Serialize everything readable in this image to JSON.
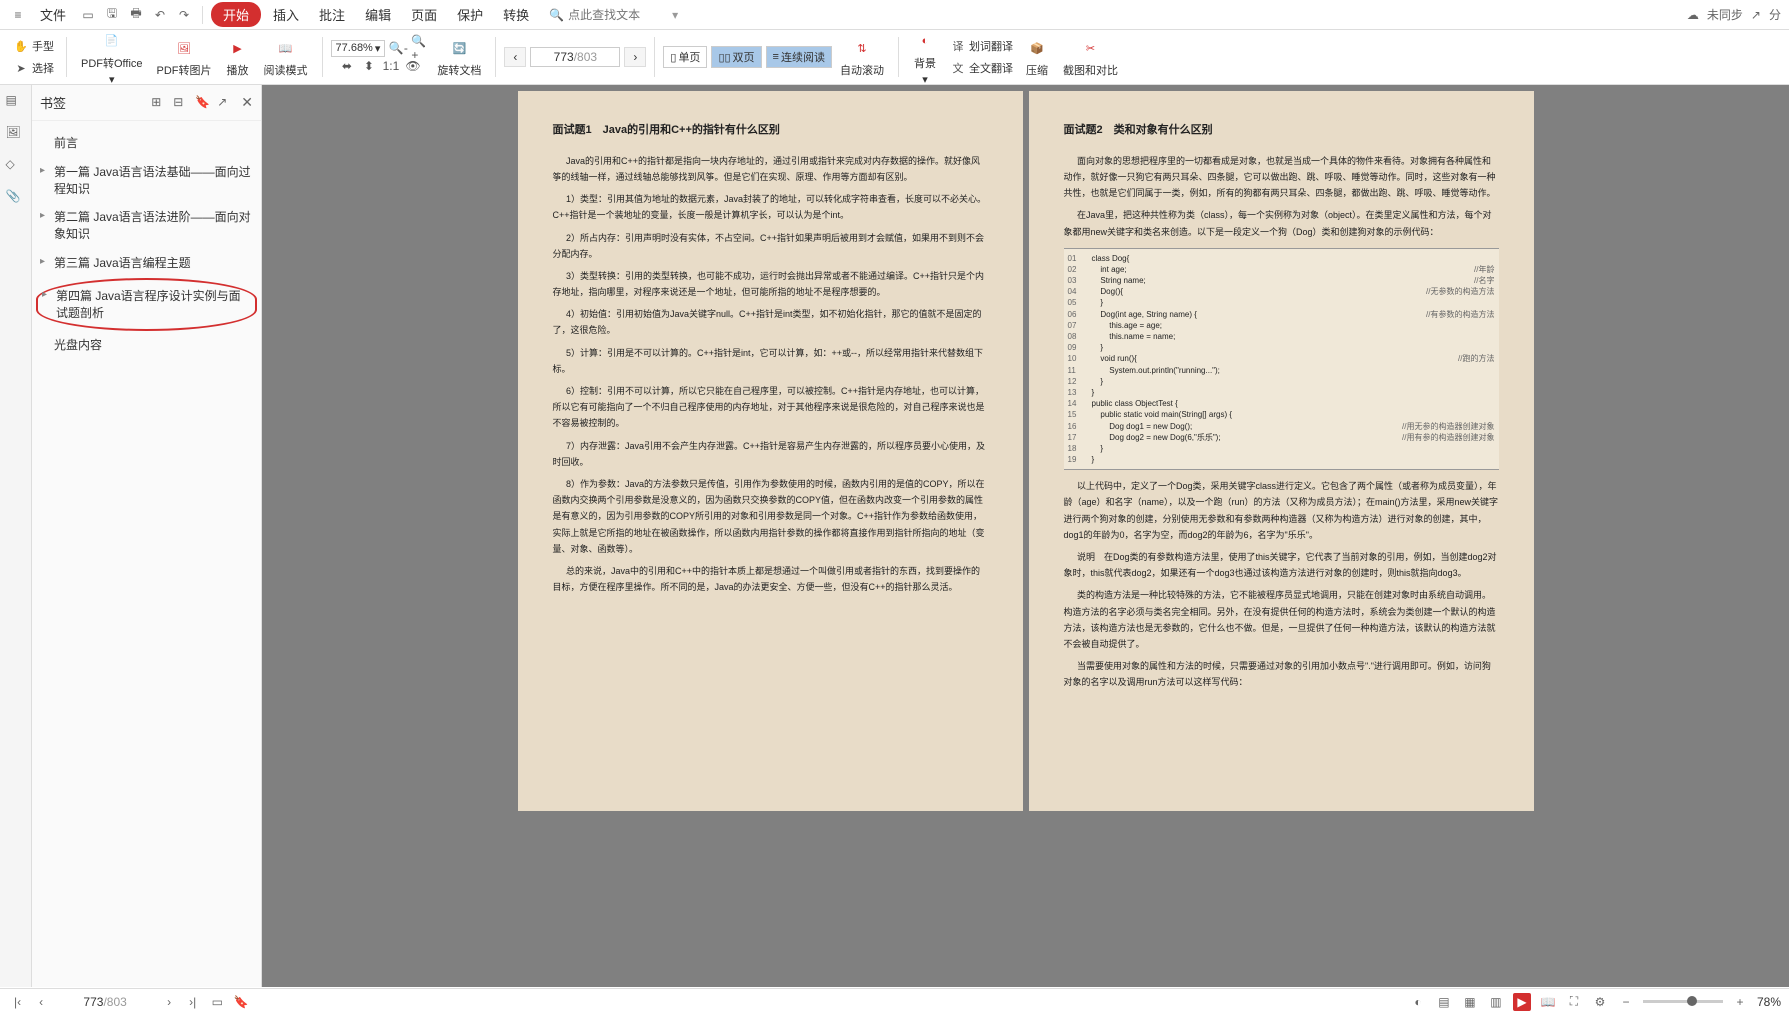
{
  "menu": {
    "file": "文件",
    "start": "开始",
    "insert": "插入",
    "review": "批注",
    "edit": "编辑",
    "page": "页面",
    "protect": "保护",
    "convert": "转换"
  },
  "search_placeholder": "点此查找文本",
  "sync_status": "未同步",
  "tools": {
    "hand": "手型",
    "select": "选择",
    "pdf_office": "PDF转Office",
    "pdf_image": "PDF转图片",
    "play": "播放",
    "read_mode": "阅读模式",
    "zoom": "77.68%",
    "rotate": "旋转文档",
    "single": "单页",
    "double": "双页",
    "continuous": "连续阅读",
    "auto_scroll": "自动滚动",
    "background": "背景",
    "word_translate": "划词翻译",
    "full_translate": "全文翻译",
    "compress": "压缩",
    "crop_compare": "截图和对比"
  },
  "page_nav": {
    "current": "773",
    "total": "/803"
  },
  "bookmarks": {
    "title": "书签",
    "items": [
      {
        "label": "前言",
        "children": false
      },
      {
        "label": "第一篇 Java语言语法基础――面向过程知识",
        "children": true
      },
      {
        "label": "第二篇 Java语言语法进阶――面向对象知识",
        "children": true
      },
      {
        "label": "第三篇 Java语言编程主题",
        "children": true
      },
      {
        "label": "第四篇 Java语言程序设计实例与面试题剖析",
        "children": true,
        "highlighted": true
      },
      {
        "label": "光盘内容",
        "children": false
      }
    ]
  },
  "doc": {
    "left": {
      "title": "面试题1　Java的引用和C++的指针有什么区别",
      "paras": [
        "Java的引用和C++的指针都是指向一块内存地址的，通过引用或指针来完成对内存数据的操作。就好像风筝的线轴一样，通过线轴总能够找到风筝。但是它们在实现、原理、作用等方面却有区别。",
        "1）类型：引用其值为地址的数据元素，Java封装了的地址，可以转化成字符串查看，长度可以不必关心。C++指针是一个装地址的变量，长度一般是计算机字长，可以认为是个int。",
        "2）所占内存：引用声明时没有实体，不占空间。C++指针如果声明后被用到才会赋值，如果用不到则不会分配内存。",
        "3）类型转换：引用的类型转换，也可能不成功，运行时会抛出异常或者不能通过编译。C++指针只是个内存地址，指向哪里，对程序来说还是一个地址，但可能所指的地址不是程序想要的。",
        "4）初始值：引用初始值为Java关键字null。C++指针是int类型，如不初始化指针，那它的值就不是固定的了，这很危险。",
        "5）计算：引用是不可以计算的。C++指针是int，它可以计算，如：++或--，所以经常用指针来代替数组下标。",
        "6）控制：引用不可以计算，所以它只能在自己程序里，可以被控制。C++指针是内存地址，也可以计算，所以它有可能指向了一个不归自己程序使用的内存地址，对于其他程序来说是很危险的，对自己程序来说也是不容易被控制的。",
        "7）内存泄露：Java引用不会产生内存泄露。C++指针是容易产生内存泄露的，所以程序员要小心使用，及时回收。",
        "8）作为参数：Java的方法参数只是传值，引用作为参数使用的时候，函数内引用的是值的COPY，所以在函数内交换两个引用参数是没意义的，因为函数只交换参数的COPY值，但在函数内改变一个引用参数的属性是有意义的，因为引用参数的COPY所引用的对象和引用参数是同一个对象。C++指针作为参数给函数使用，实际上就是它所指的地址在被函数操作，所以函数内用指针参数的操作都将直接作用到指针所指向的地址（变量、对象、函数等）。",
        "总的来说，Java中的引用和C++中的指针本质上都是想通过一个叫做引用或者指针的东西，找到要操作的目标，方便在程序里操作。所不同的是，Java的办法更安全、方便一些，但没有C++的指针那么灵活。"
      ]
    },
    "right": {
      "title": "面试题2　类和对象有什么区别",
      "paras_top": [
        "面向对象的思想把程序里的一切都看成是对象，也就是当成一个具体的物件来看待。对象拥有各种属性和动作，就好像一只狗它有两只耳朵、四条腿，它可以做出跑、跳、呼吸、睡觉等动作。同时，这些对象有一种共性，也就是它们同属于一类，例如，所有的狗都有两只耳朵、四条腿，都做出跑、跳、呼吸、睡觉等动作。",
        "在Java里，把这种共性称为类（class），每一个实例称为对象（object）。在类里定义属性和方法，每个对象都用new关键字和类名来创造。以下是一段定义一个狗（Dog）类和创建狗对象的示例代码："
      ],
      "code": [
        {
          "ln": "01",
          "c": "class Dog{"
        },
        {
          "ln": "02",
          "c": "    int age;",
          "cmt": "//年龄"
        },
        {
          "ln": "03",
          "c": "    String name;",
          "cmt": "//名字"
        },
        {
          "ln": "04",
          "c": "    Dog(){",
          "cmt": "//无参数的构造方法"
        },
        {
          "ln": "05",
          "c": "    }"
        },
        {
          "ln": "06",
          "c": "    Dog(int age, String name) {",
          "cmt": "//有参数的构造方法"
        },
        {
          "ln": "07",
          "c": "        this.age = age;"
        },
        {
          "ln": "08",
          "c": "        this.name = name;"
        },
        {
          "ln": "09",
          "c": "    }"
        },
        {
          "ln": "10",
          "c": "    void run(){",
          "cmt": "//跑的方法"
        },
        {
          "ln": "11",
          "c": "        System.out.println(\"running...\");"
        },
        {
          "ln": "12",
          "c": "    }"
        },
        {
          "ln": "13",
          "c": "}"
        },
        {
          "ln": "14",
          "c": "public class ObjectTest {"
        },
        {
          "ln": "15",
          "c": "    public static void main(String[] args) {"
        },
        {
          "ln": "16",
          "c": "        Dog dog1 = new Dog();",
          "cmt": "//用无参的构造器创建对象"
        },
        {
          "ln": "17",
          "c": "        Dog dog2 = new Dog(6,\"乐乐\");",
          "cmt": "//用有参的构造器创建对象"
        },
        {
          "ln": "18",
          "c": "    }"
        },
        {
          "ln": "19",
          "c": "}"
        }
      ],
      "paras_bottom": [
        "以上代码中，定义了一个Dog类，采用关键字class进行定义。它包含了两个属性（或者称为成员变量），年龄（age）和名字（name），以及一个跑（run）的方法（又称为成员方法）；在main()方法里，采用new关键字进行两个狗对象的创建，分别使用无参数和有参数两种构造器（又称为构造方法）进行对象的创建，其中，dog1的年龄为0，名字为空，而dog2的年龄为6，名字为\"乐乐\"。",
        "说明　在Dog类的有参数构造方法里，使用了this关键字，它代表了当前对象的引用，例如，当创建dog2对象时，this就代表dog2，如果还有一个dog3也通过该构造方法进行对象的创建时，则this就指向dog3。",
        "类的构造方法是一种比较特殊的方法，它不能被程序员显式地调用，只能在创建对象时由系统自动调用。构造方法的名字必须与类名完全相同。另外，在没有提供任何的构造方法时，系统会为类创建一个默认的构造方法，该构造方法也是无参数的，它什么也不做。但是，一旦提供了任何一种构造方法，该默认的构造方法就不会被自动提供了。",
        "当需要使用对象的属性和方法的时候，只需要通过对象的引用加小数点号\".\"进行调用即可。例如，访问狗对象的名字以及调用run方法可以这样写代码："
      ]
    }
  },
  "status": {
    "page": "773",
    "total": "/803",
    "zoom": "78%"
  }
}
